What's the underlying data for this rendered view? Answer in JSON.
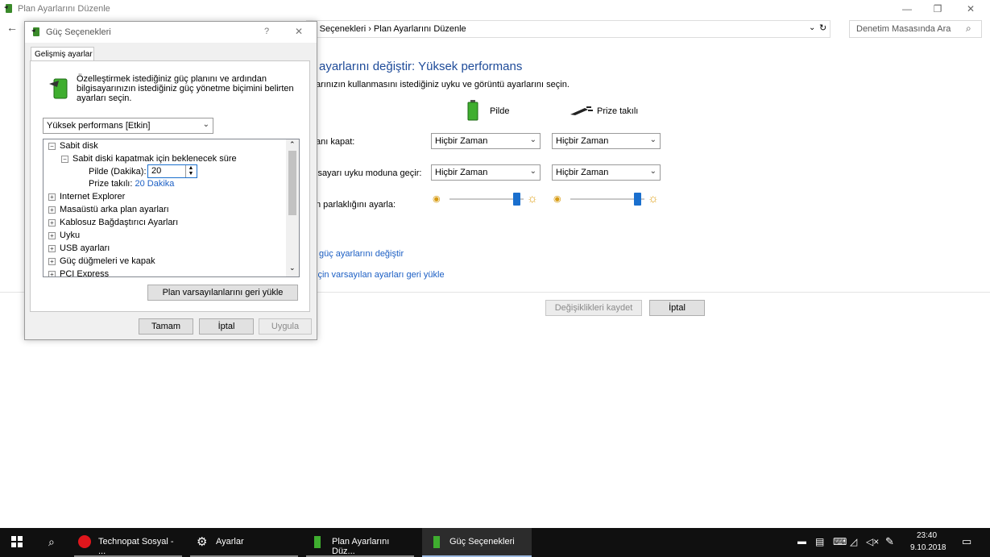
{
  "window": {
    "title": "Plan Ayarlarını Düzenle"
  },
  "address": {
    "crumb": "üç Seçenekleri  ›  Plan Ayarlarını Düzenle",
    "search_placeholder": "Denetim Masasında Ara"
  },
  "main": {
    "heading": "ayarlarını değiştir: Yüksek performans",
    "subtitle": "arınızın kullanmasını istediğiniz uyku ve görüntü ayarlarını seçin.",
    "col_battery": "Pilde",
    "col_plugged": "Prize takılı",
    "rows": [
      {
        "label": "anı kapat:",
        "battery": "Hiçbir Zaman",
        "plugged": "Hiçbir Zaman"
      },
      {
        "label": "isayarı uyku moduna geçir:",
        "battery": "Hiçbir Zaman",
        "plugged": "Hiçbir Zaman"
      }
    ],
    "brightness_label": "n parlaklığını ayarla:",
    "brightness_battery": 0.95,
    "brightness_plugged": 0.95,
    "link_advanced": "güç ayarlarını değiştir",
    "link_restore": "için varsayılan ayarları geri yükle",
    "save_label": "Değişiklikleri kaydet",
    "cancel_label": "İptal"
  },
  "dialog": {
    "title": "Güç Seçenekleri",
    "help": "?",
    "close": "✕",
    "tab": "Gelişmiş ayarlar",
    "description": "Özelleştirmek istediğiniz güç planını ve ardından bilgisayarınızın istediğiniz güç yönetme biçimini belirten ayarları seçin.",
    "plan_selected": "Yüksek performans [Etkin]",
    "tree": {
      "hard_disk": "Sabit disk",
      "turn_off_after": "Sabit diski kapatmak için beklenecek süre",
      "battery_label": "Pilde (Dakika):",
      "battery_value": "20",
      "plugged_label": "Prize takılı:",
      "plugged_value": "20 Dakika",
      "items": [
        "Internet Explorer",
        "Masaüstü arka plan ayarları",
        "Kablosuz Bağdaştırıcı Ayarları",
        "Uyku",
        "USB ayarları",
        "Güç düğmeleri ve kapak",
        "PCI Express"
      ]
    },
    "restore_label": "Plan varsayılanlarını geri yükle",
    "ok_label": "Tamam",
    "cancel_label": "İptal",
    "apply_label": "Uygula"
  },
  "taskbar": {
    "items": [
      "Technopat Sosyal - ...",
      "Ayarlar",
      "Plan Ayarlarını Düz...",
      "Güç Seçenekleri"
    ],
    "time": "23:40",
    "date": "9.10.2018"
  },
  "colors": {
    "accent": "#1a6fce",
    "link": "#1c5fc4",
    "heading": "#1e4b99",
    "taskbar": "#101010"
  }
}
